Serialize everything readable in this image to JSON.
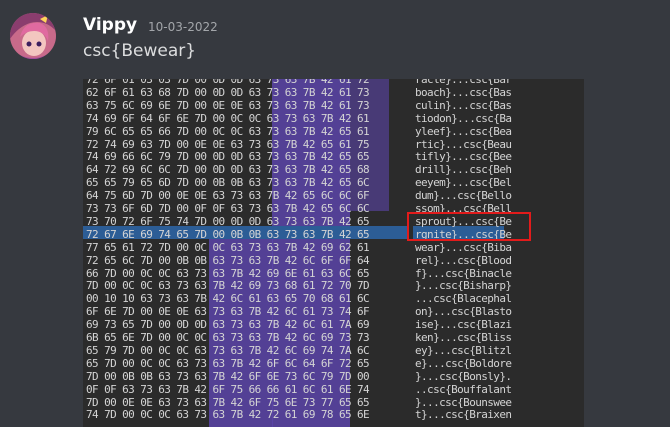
{
  "message": {
    "username": "Vippy",
    "timestamp": "10-03-2022",
    "text": "csc{Bewear}"
  },
  "hex_rows": [
    "72 6F 01 03 03 7D 00 0D 0D 63 73 63 7B 42 61 72",
    "62 6F 61 63 68 7D 00 0D 0D 63 73 63 7B 42 61 73",
    "63 75 6C 69 6E 7D 00 0E 0E 63 73 63 7B 42 61 73",
    "74 69 6F 64 6F 6E 7D 00 0C 0C 63 73 63 7B 42 61",
    "79 6C 65 65 66 7D 00 0C 0C 63 73 63 7B 42 65 61",
    "72 74 69 63 7D 00 0E 0E 63 73 63 7B 42 65 61 75",
    "74 69 66 6C 79 7D 00 0D 0D 63 73 63 7B 42 65 65",
    "64 72 69 6C 6C 7D 00 0D 0D 63 73 63 7B 42 65 68",
    "65 65 79 65 6D 7D 00 0B 0B 63 73 63 7B 42 65 6C",
    "64 75 6D 7D 00 0E 0E 63 73 63 7B 42 65 6C 6C 6F",
    "73 73 6F 6D 7D 00 0F 0F 63 73 63 7B 42 65 6C 6C",
    "73 70 72 6F 75 74 7D 00 0D 0D 63 73 63 7B 42 65",
    "72 67 6E 69 74 65 7D 00 0B 0B 63 73 63 7B 42 65",
    "77 65 61 72 7D 00 0C 0C 63 73 63 7B 42 69 62 61",
    "72 65 6C 7D 00 0B 0B 63 73 63 7B 42 6C 6F 6F 64",
    "66 7D 00 0C 0C 63 73 63 7B 42 69 6E 61 63 6C 65",
    "7D 00 0C 0C 63 73 63 7B 42 69 73 68 61 72 70 7D",
    "00 10 10 63 73 63 7B 42 6C 61 63 65 70 68 61 6C",
    "6F 6E 7D 00 0E 0E 63 73 63 7B 42 6C 61 73 74 6F",
    "69 73 65 7D 00 0D 0D 63 73 63 7B 42 6C 61 7A 69",
    "6B 65 6E 7D 00 0C 0C 63 73 63 7B 42 6C 69 73 73",
    "65 79 7D 00 0C 0C 63 73 63 7B 42 6C 69 74 7A 6C",
    "65 7D 00 0C 0C 63 73 63 7B 42 6F 6C 64 6F 72 65",
    "7D 00 0B 0B 63 73 63 7B 42 6F 6E 73 6C 79 7D 00",
    "0F 0F 63 73 63 7B 42 6F 75 66 66 61 6C 61 6E 74",
    "7D 00 0E 0E 63 73 63 7B 42 6F 75 6E 73 77 65 65",
    "74 7D 00 0C 0C 63 73 63 7B 42 72 61 69 78 65 6E"
  ],
  "ascii_rows": [
    "racle}...csc{Bar",
    "boach}...csc{Bas",
    "culin}...csc{Bas",
    "tiodon}...csc{Ba",
    "yleef}...csc{Bea",
    "rtic}...csc{Beau",
    "tifly}...csc{Bee",
    "drill}...csc{Beh",
    "eeyem}...csc{Bel",
    "dum}...csc{Bello",
    "ssom}...csc{Bell",
    "sprout}...csc{Be",
    "rgnite}...csc{Be",
    "wear}...csc{Biba",
    "rel}...csc{Blood",
    "f}...csc{Binacle",
    "}...csc{Bisharp}",
    "...csc{Blacephal",
    "on}...csc{Blasto",
    "ise}...csc{Blazi",
    "ken}...csc{Bliss",
    "ey}...csc{Blitzl",
    "e}...csc{Boldore",
    "}...csc{Bonsly}.",
    "..csc{Bouffalant",
    "}...csc{Bounswee",
    "t}...csc{Braixen"
  ],
  "colors": {
    "background": "#36393f",
    "attachment_bg": "#2b2b2b",
    "highlight_purple": "#5b44a8",
    "selection_blue": "#2c5d96",
    "annotation_red": "#e21b1b"
  }
}
